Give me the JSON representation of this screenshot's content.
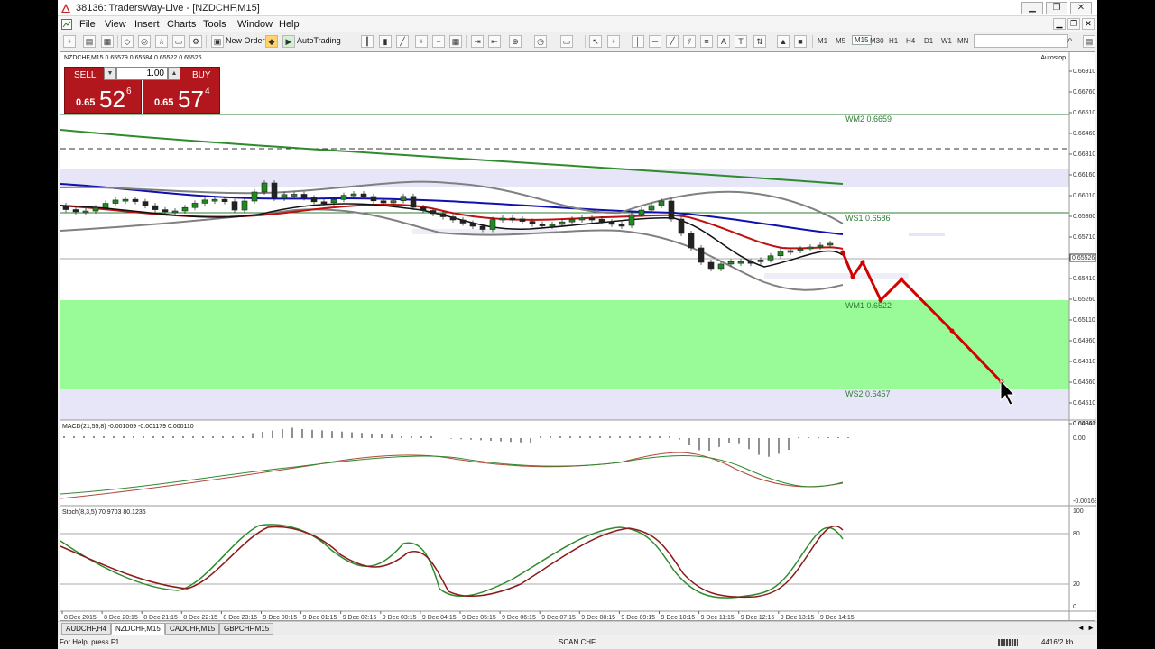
{
  "window": {
    "title": "38136: TradersWay-Live - [NZDCHF,M15]",
    "buttons": {
      "minimize": "▁",
      "restore": "❐",
      "close": "✕"
    }
  },
  "menu": {
    "items": [
      "File",
      "View",
      "Insert",
      "Charts",
      "Tools",
      "Window",
      "Help"
    ]
  },
  "toolbar": {
    "new_order": "New Order",
    "autotrading": "AutoTrading",
    "timeframes": [
      "M1",
      "M5",
      "M15",
      "M30",
      "H1",
      "H4",
      "D1",
      "W1",
      "MN"
    ],
    "active_timeframe": "M15"
  },
  "chart": {
    "symbol_info": "NZDCHF,M15  0.65579 0.65584 0.65522 0.65526",
    "autostop": "Autostop",
    "current_price": "0.65526",
    "price_axis": [
      "0.66910",
      "0.66760",
      "0.66610",
      "0.66460",
      "0.66310",
      "0.66160",
      "0.66010",
      "0.65860",
      "0.65710",
      "0.65560",
      "0.65410",
      "0.65260",
      "0.65110",
      "0.64960",
      "0.64810",
      "0.64660",
      "0.64510",
      "0.64360"
    ],
    "levels": {
      "wm2": "WM2 0.6659",
      "ws1": "WS1 0.6586",
      "wm1": "WM1 0.6522",
      "ws2": "WS2 0.6457"
    },
    "macd_label": "MACD(21,55,8) -0.001069 -0.001179 0.000110",
    "macd_axis": [
      "0.000419",
      "0.00",
      "-0.001634"
    ],
    "stoch_label": "Stoch(8,3,5) 70.9703 80.1236",
    "stoch_axis": [
      "100",
      "80",
      "20",
      "0"
    ],
    "time_axis": [
      "8 Dec 2015",
      "8 Dec 20:15",
      "8 Dec 21:15",
      "8 Dec 22:15",
      "8 Dec 23:15",
      "9 Dec 00:15",
      "9 Dec 01:15",
      "9 Dec 02:15",
      "9 Dec 03:15",
      "9 Dec 04:15",
      "9 Dec 05:15",
      "9 Dec 06:15",
      "9 Dec 07:15",
      "9 Dec 08:15",
      "9 Dec 09:15",
      "9 Dec 10:15",
      "9 Dec 11:15",
      "9 Dec 12:15",
      "9 Dec 13:15",
      "9 Dec 14:15"
    ]
  },
  "trade_panel": {
    "sell_label": "SELL",
    "buy_label": "BUY",
    "lot": "1.00",
    "sell_prefix": "0.65",
    "sell_big": "52",
    "sell_sup": "6",
    "buy_prefix": "0.65",
    "buy_big": "57",
    "buy_sup": "4"
  },
  "tabs": [
    "AUDCHF,H4",
    "NZDCHF,M15",
    "CADCHF,M15",
    "GBPCHF,M15"
  ],
  "active_tab": "NZDCHF,M15",
  "status": {
    "help": "For Help, press F1",
    "profile": "SCAN CHF",
    "traffic": "4416/2 kb"
  },
  "colors": {
    "sell_buy_bg": "#b3171e",
    "wm_zone": "#98fb98",
    "ws_zone": "#e6e6f8",
    "projection": "#d40000",
    "ma_blue": "#1010b0",
    "ma_red": "#c01010",
    "ma_green": "#2e8b2e",
    "bands": "#808080"
  }
}
